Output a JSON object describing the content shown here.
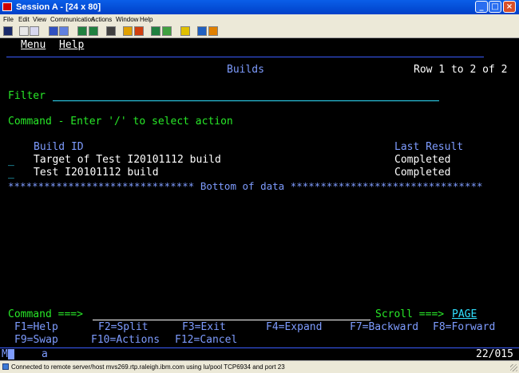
{
  "window": {
    "title": "Session A - [24 x 80]"
  },
  "menubar": [
    "File",
    "Edit",
    "View",
    "Communication",
    "Actions",
    "Window",
    "Help"
  ],
  "toolbar_icons": [
    "print-screen-icon",
    "copy-icon",
    "paste-icon",
    "send-icon",
    "receive-icon",
    "display-icon",
    "macro-icon",
    "color-icon",
    "record-macro-icon",
    "stop-macro-icon",
    "play-macro-icon",
    "keyboard-icon",
    "support-icon",
    "help-icon"
  ],
  "screen": {
    "menu": "Menu",
    "help": "Help",
    "title": "Builds",
    "row_info": "Row 1 to 2 of 2",
    "filter_label": "Filter",
    "command_hint": "Command - Enter '/' to select action",
    "columns": {
      "build_id": "Build ID",
      "last_result": "Last Result"
    },
    "rows": [
      {
        "select": "_",
        "build_id": "Target of Test I20101112 build",
        "last_result": "Completed"
      },
      {
        "select": "_",
        "build_id": "Test I20101112 build",
        "last_result": "Completed"
      }
    ],
    "bottom_of_data": "******************************* Bottom of data ********************************",
    "command_prompt": "Command ===>",
    "scroll_prompt": "Scroll ===>",
    "scroll_value": "PAGE",
    "fkeys_line1": [
      {
        "key": "F1",
        "label": "Help"
      },
      {
        "key": "F2",
        "label": "Split"
      },
      {
        "key": "F3",
        "label": "Exit"
      },
      {
        "key": "F4",
        "label": "Expand"
      },
      {
        "key": "F7",
        "label": "Backward"
      },
      {
        "key": "F8",
        "label": "Forward"
      }
    ],
    "fkeys_line2": [
      {
        "key": "F9",
        "label": "Swap"
      },
      {
        "key": "F10",
        "label": "Actions"
      },
      {
        "key": "F12",
        "label": "Cancel"
      }
    ]
  },
  "oia": {
    "session": "MA",
    "indicator": "a",
    "cursor": "22/015"
  },
  "status_bar": {
    "text": "Connected to remote server/host mvs269.rtp.raleigh.ibm.com using lu/pool TCP6934 and port 23"
  },
  "colors": {
    "green": "#28e828",
    "blue": "#7e9cff",
    "white": "#ffffff",
    "cyan": "#30e0ff",
    "yellow": "#ffff00"
  }
}
